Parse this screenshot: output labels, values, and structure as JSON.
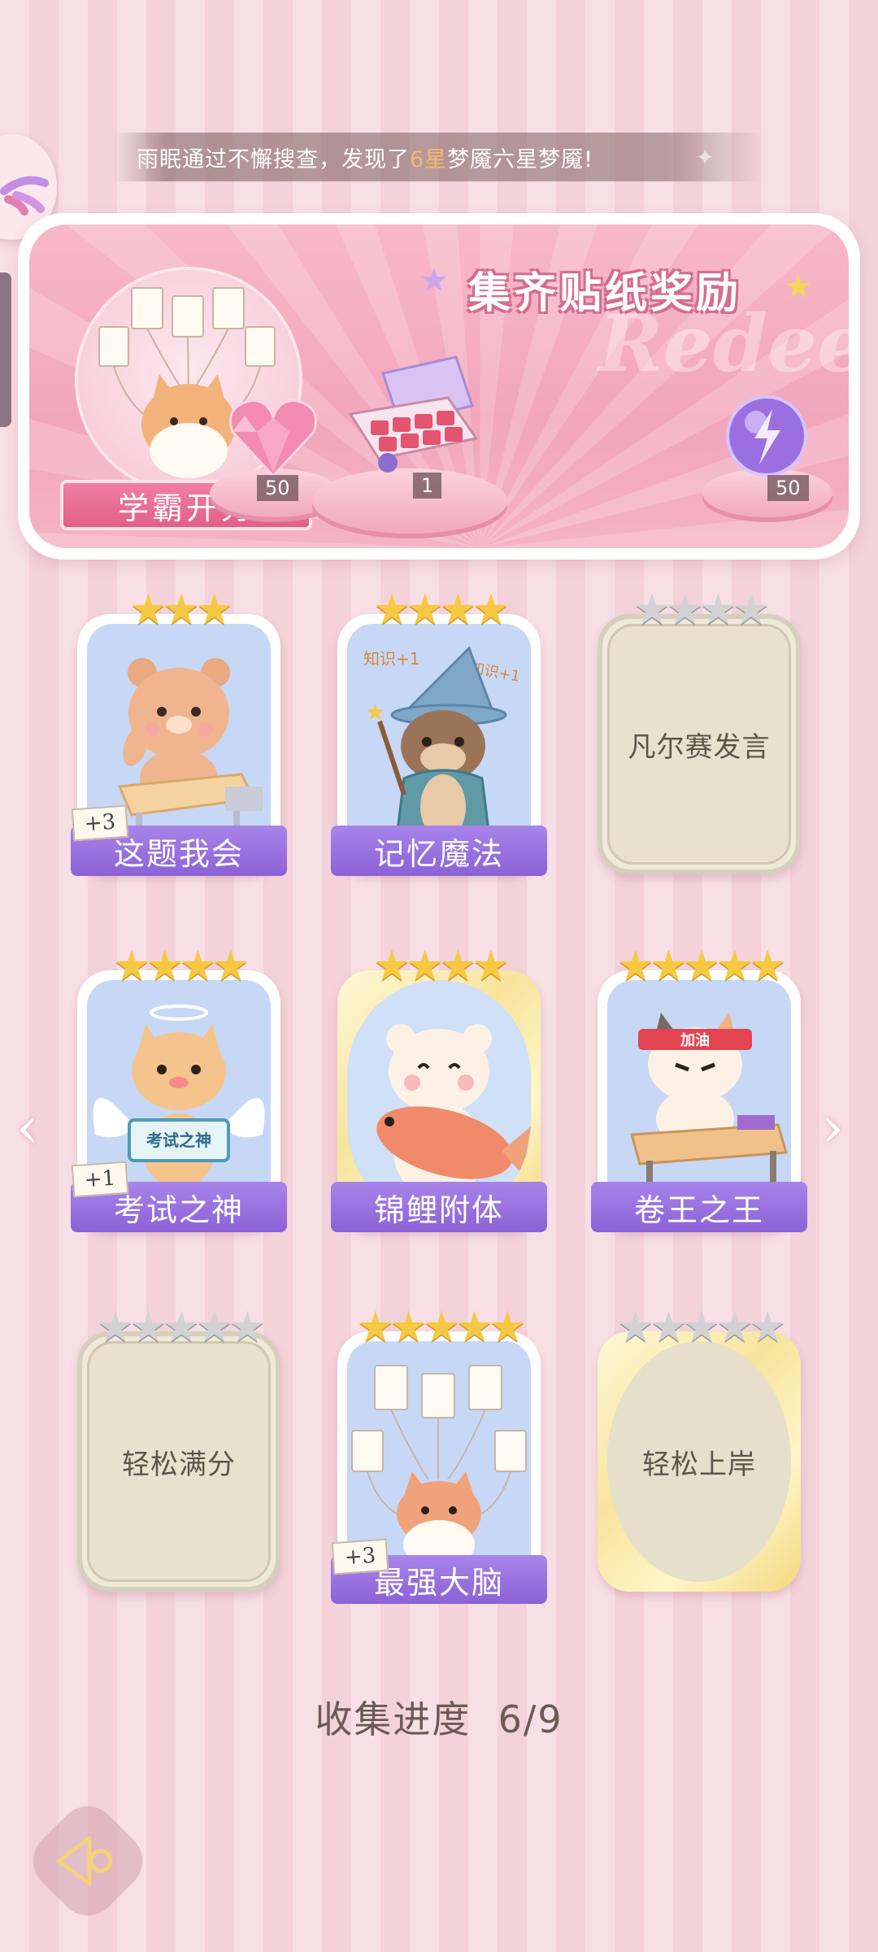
{
  "notice": {
    "prefix": "雨眠通过不懈搜查，发现了",
    "highlight": "6星",
    "suffix": "梦魇六星梦魇!"
  },
  "banner": {
    "title": "集齐贴纸奖励",
    "watermark": "Redeem",
    "badge": "学霸开秀",
    "rewards": [
      {
        "name": "heart-gem",
        "count": "50"
      },
      {
        "name": "gift-box",
        "count": "1"
      },
      {
        "name": "energy-orb",
        "count": "50"
      }
    ]
  },
  "cards": [
    {
      "label": "这题我会",
      "stars": 3,
      "star_color": "gold",
      "state": "collected",
      "plus": "+3"
    },
    {
      "label": "记忆魔法",
      "stars": 4,
      "star_color": "gold",
      "state": "collected",
      "plus": ""
    },
    {
      "label": "凡尔赛发言",
      "stars": 4,
      "star_color": "silver",
      "state": "locked",
      "plus": ""
    },
    {
      "label": "考试之神",
      "stars": 4,
      "star_color": "gold",
      "state": "collected",
      "plus": "+1"
    },
    {
      "label": "锦鲤附体",
      "stars": 4,
      "star_color": "gold",
      "state": "collected",
      "plus": ""
    },
    {
      "label": "卷王之王",
      "stars": 5,
      "star_color": "gold",
      "state": "collected",
      "plus": ""
    },
    {
      "label": "轻松满分",
      "stars": 5,
      "star_color": "silver",
      "state": "locked",
      "plus": ""
    },
    {
      "label": "最强大脑",
      "stars": 5,
      "star_color": "gold",
      "state": "collected",
      "plus": "+3"
    },
    {
      "label": "轻松上岸",
      "stars": 5,
      "star_color": "silver",
      "state": "locked",
      "plus": ""
    }
  ],
  "art_text": {
    "zhishi_1": "知识+1",
    "zhishi_2": "知识+1",
    "exam_sign": "考试之神",
    "headband": "加油"
  },
  "progress": {
    "label": "收集进度",
    "value": "6/9"
  }
}
